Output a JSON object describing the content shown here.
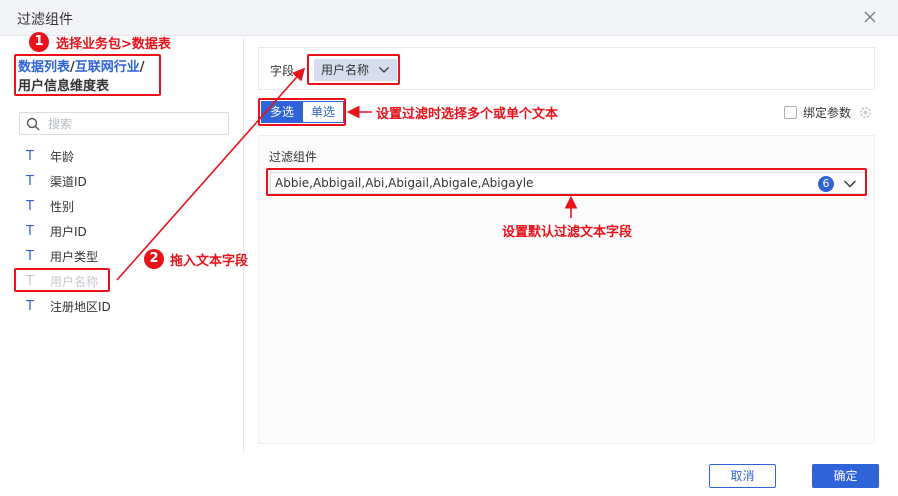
{
  "dialog": {
    "title": "过滤组件"
  },
  "left": {
    "breadcrumb": {
      "part1": "数据列表",
      "sep1": "/",
      "part2": "互联网行业",
      "sep2": "/",
      "current": "用户信息维度表"
    },
    "search": {
      "placeholder": "搜索",
      "value": ""
    },
    "fields": [
      {
        "type": "T",
        "label": "年龄"
      },
      {
        "type": "T",
        "label": "渠道ID"
      },
      {
        "type": "T",
        "label": "性别"
      },
      {
        "type": "T",
        "label": "用户ID"
      },
      {
        "type": "T",
        "label": "用户类型"
      },
      {
        "type": "T",
        "label": "用户名称"
      },
      {
        "type": "T",
        "label": "注册地区ID"
      }
    ]
  },
  "right": {
    "field_label": "字段",
    "field_chip": "用户名称",
    "mode": {
      "multi": "多选",
      "single": "单选"
    },
    "bind_label": "绑定参数",
    "panel": {
      "label": "过滤组件",
      "value": "Abbie,Abbigail,Abi,Abigail,Abigale,Abigayle",
      "count": "6"
    }
  },
  "footer": {
    "cancel": "取消",
    "ok": "确定"
  },
  "annotations": {
    "step1": {
      "num": "1",
      "text": "选择业务包>数据表"
    },
    "step2": {
      "num": "2",
      "text": "拖入文本字段"
    },
    "mode_note": "设置过滤时选择多个或单个文本",
    "default_note": "设置默认过滤文本字段"
  },
  "colors": {
    "accent": "#2f63d8",
    "annotation": "#e8121b"
  }
}
